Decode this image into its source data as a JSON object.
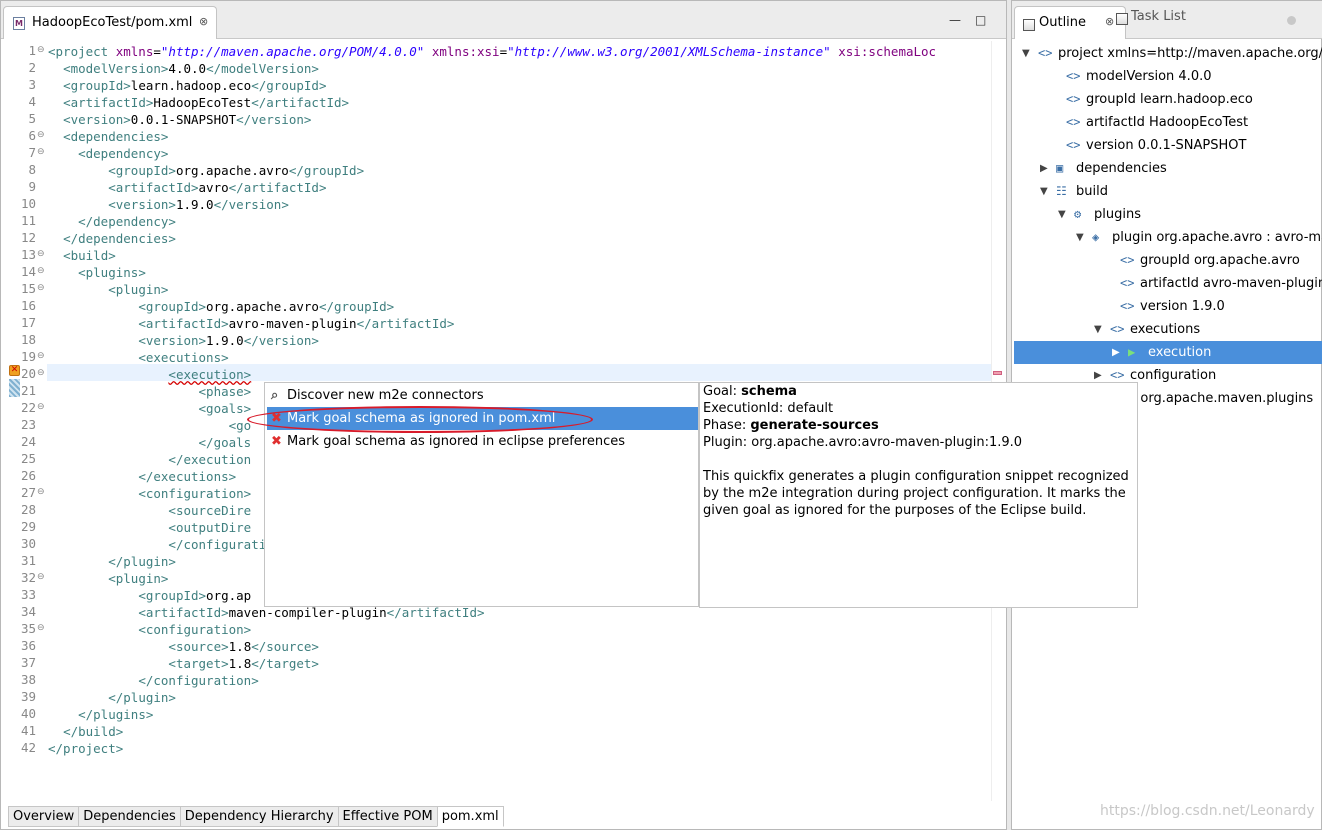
{
  "editor": {
    "tab_title": "HadoopEcoTest/pom.xml",
    "tab_icon": "M",
    "close_glyph": "⊗",
    "minimize_glyph": "—",
    "maximize_glyph": "□"
  },
  "code_lines": [
    {
      "n": "1"
    },
    {
      "n": "2"
    },
    {
      "n": "3"
    },
    {
      "n": "4"
    },
    {
      "n": "5"
    },
    {
      "n": "6"
    },
    {
      "n": "7"
    },
    {
      "n": "8"
    },
    {
      "n": "9"
    },
    {
      "n": "10"
    },
    {
      "n": "11"
    },
    {
      "n": "12"
    },
    {
      "n": "13"
    },
    {
      "n": "14"
    },
    {
      "n": "15"
    },
    {
      "n": "16"
    },
    {
      "n": "17"
    },
    {
      "n": "18"
    },
    {
      "n": "19"
    },
    {
      "n": "20"
    },
    {
      "n": "21"
    },
    {
      "n": "22"
    },
    {
      "n": "23"
    },
    {
      "n": "24"
    },
    {
      "n": "25"
    },
    {
      "n": "26"
    },
    {
      "n": "27"
    },
    {
      "n": "28"
    },
    {
      "n": "29"
    },
    {
      "n": "30"
    },
    {
      "n": "31"
    },
    {
      "n": "32"
    },
    {
      "n": "33"
    },
    {
      "n": "34"
    },
    {
      "n": "35"
    },
    {
      "n": "36"
    },
    {
      "n": "37"
    },
    {
      "n": "38"
    },
    {
      "n": "39"
    },
    {
      "n": "40"
    },
    {
      "n": "41"
    },
    {
      "n": "42"
    }
  ],
  "code": {
    "l1_tag": "<project ",
    "l1_a1": "xmlns",
    "l1_eq1": "=",
    "l1_v1": "\"http://maven.apache.org/POM/4.0.0\"",
    "l1_a2": " xmlns:xsi",
    "l1_eq2": "=",
    "l1_v2": "\"http://www.w3.org/2001/XMLSchema-instance\"",
    "l1_a3": " xsi:schemaLoc",
    "l2_o": "<modelVersion>",
    "l2_t": "4.0.0",
    "l2_c": "</modelVersion>",
    "l3_o": "<groupId>",
    "l3_t": "learn.hadoop.eco",
    "l3_c": "</groupId>",
    "l4_o": "<artifactId>",
    "l4_t": "HadoopEcoTest",
    "l4_c": "</artifactId>",
    "l5_o": "<version>",
    "l5_t": "0.0.1-SNAPSHOT",
    "l5_c": "</version>",
    "l6": "<dependencies>",
    "l7": "<dependency>",
    "l8_o": "<groupId>",
    "l8_t": "org.apache.avro",
    "l8_c": "</groupId>",
    "l9_o": "<artifactId>",
    "l9_t": "avro",
    "l9_c": "</artifactId>",
    "l10_o": "<version>",
    "l10_t": "1.9.0",
    "l10_c": "</version>",
    "l11": "</dependency>",
    "l12": "</dependencies>",
    "l13": "<build>",
    "l14": "<plugins>",
    "l15": "<plugin>",
    "l16_o": "<groupId>",
    "l16_t": "org.apache.avro",
    "l16_c": "</groupId>",
    "l17_o": "<artifactId>",
    "l17_t": "avro-maven-plugin",
    "l17_c": "</artifactId>",
    "l18_o": "<version>",
    "l18_t": "1.9.0",
    "l18_c": "</version>",
    "l19": "<executions>",
    "l20": "<execution>",
    "l21": "<phase>",
    "l22": "<goals>",
    "l23": "<go",
    "l24": "</goals",
    "l25": "</execution",
    "l26": "</executions>",
    "l27": "<configuration>",
    "l28": "<sourceDire",
    "l29": "<outputDire",
    "l30": "</configuration",
    "l31": "</plugin>",
    "l32": "<plugin>",
    "l33_o": "<groupId>",
    "l33_t": "org.ap",
    "l34_o": "<artifactId>",
    "l34_t": "maven-compiler-plugin",
    "l34_c": "</artifactId>",
    "l35": "<configuration>",
    "l36_o": "<source>",
    "l36_t": "1.8",
    "l36_c": "</source>",
    "l37_o": "<target>",
    "l37_t": "1.8",
    "l37_c": "</target>",
    "l38": "</configuration>",
    "l39": "</plugin>",
    "l40": "</plugins>",
    "l41": "</build>",
    "l42": "</project>"
  },
  "bottom_tabs": [
    "Overview",
    "Dependencies",
    "Dependency Hierarchy",
    "Effective POM",
    "pom.xml"
  ],
  "outline": {
    "tab_outline": "Outline",
    "tab_tasks": "Task List",
    "close_glyph": "⊗",
    "tree": [
      {
        "label": "project xmlns=http://maven.apache.org/P",
        "icon": "<>",
        "arrow": "▼"
      },
      {
        "label": "modelVersion  4.0.0",
        "icon": "<>"
      },
      {
        "label": "groupId  learn.hadoop.eco",
        "icon": "<>"
      },
      {
        "label": "artifactId  HadoopEcoTest",
        "icon": "<>"
      },
      {
        "label": "version  0.0.1-SNAPSHOT",
        "icon": "<>"
      },
      {
        "label": "dependencies",
        "icon": "▣",
        "arrow": "▶"
      },
      {
        "label": "build",
        "icon": "☷",
        "arrow": "▼"
      },
      {
        "label": "plugins",
        "icon": "⚙",
        "arrow": "▼"
      },
      {
        "label": "plugin  org.apache.avro : avro-ma",
        "icon": "◈",
        "arrow": "▼"
      },
      {
        "label": "groupId  org.apache.avro",
        "icon": "<>"
      },
      {
        "label": "artifactId  avro-maven-plugin",
        "icon": "<>"
      },
      {
        "label": "version  1.9.0",
        "icon": "<>"
      },
      {
        "label": "executions",
        "icon": "<>",
        "arrow": "▼"
      },
      {
        "label": "execution",
        "icon": "▶",
        "arrow": "▶"
      },
      {
        "label": "configuration",
        "icon": "<>",
        "arrow": "▶"
      },
      {
        "label": "n  org.apache.maven.plugins"
      }
    ]
  },
  "quickfix": {
    "items": [
      {
        "label": "Discover new m2e connectors",
        "icon": "⌕"
      },
      {
        "label": "Mark goal schema as ignored in pom.xml",
        "icon": "✖"
      },
      {
        "label": "Mark goal schema as ignored in eclipse preferences",
        "icon": "✖"
      }
    ],
    "info": {
      "goal_label": "Goal: ",
      "goal_value": "schema",
      "exec_line": "ExecutionId: default",
      "phase_label": "Phase: ",
      "phase_value": "generate-sources",
      "plugin_line": "Plugin: org.apache.avro:avro-maven-plugin:1.9.0",
      "desc1": "This quickfix generates a plugin configuration snippet recognized",
      "desc2": " by the m2e integration during project configuration. It marks the",
      "desc3": " given goal as ignored for the purposes of the Eclipse build."
    }
  },
  "watermark": "https://blog.csdn.net/Leonardy"
}
